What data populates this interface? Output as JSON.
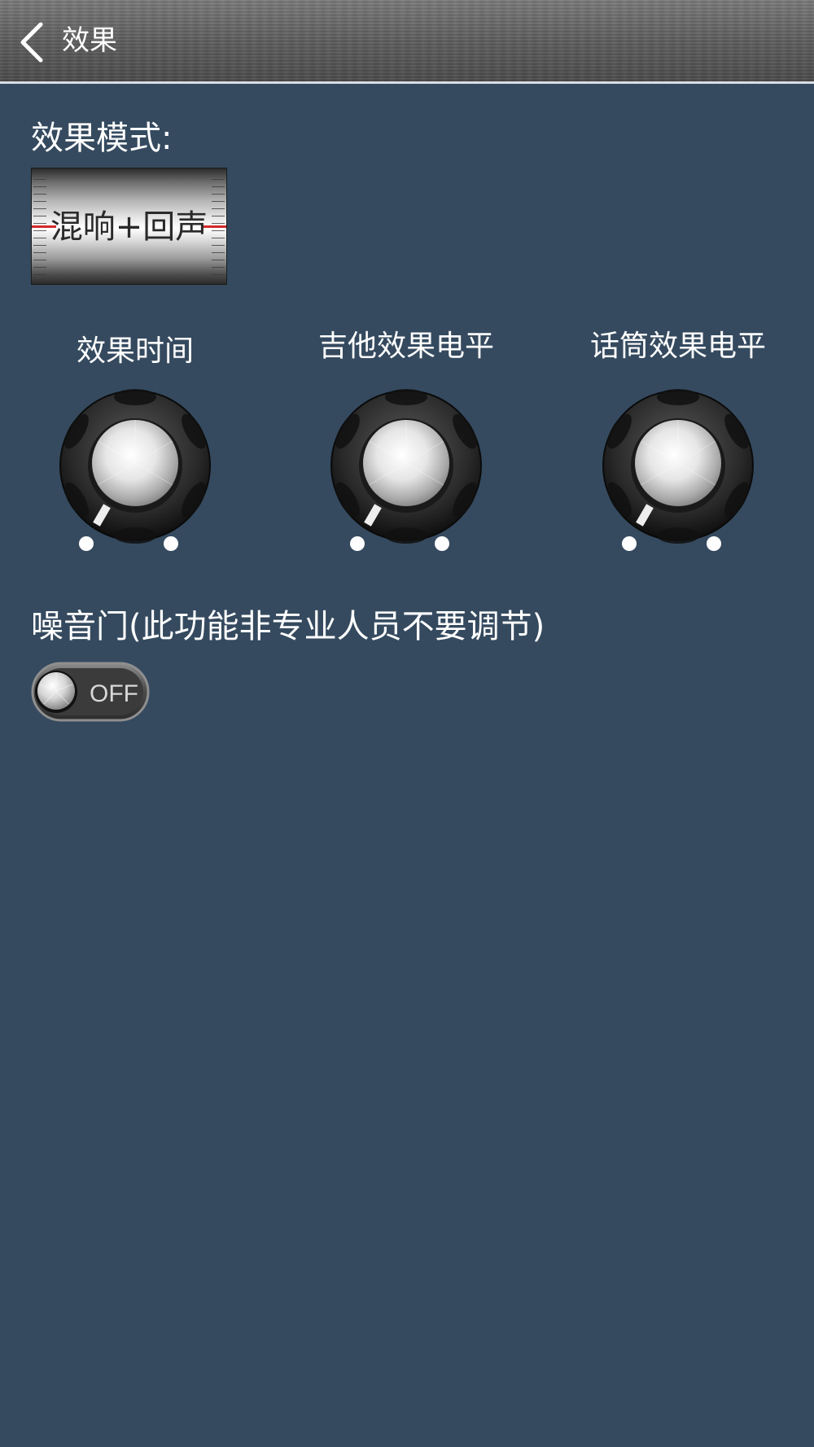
{
  "header": {
    "title": "效果",
    "back_icon": "chevron-left-icon"
  },
  "effect_mode": {
    "label": "效果模式:",
    "value": "混响+回声"
  },
  "knobs": [
    {
      "label": "效果时间",
      "icon": "rotary-knob-icon"
    },
    {
      "label": "吉他效果电平",
      "icon": "rotary-knob-icon"
    },
    {
      "label": "话筒效果电平",
      "icon": "rotary-knob-icon"
    }
  ],
  "noise_gate": {
    "label": "噪音门(此功能非专业人员不要调节)",
    "state": "OFF"
  },
  "colors": {
    "background": "#354a5f",
    "header_line": "#d8dde3",
    "indicator_red": "#d22a2a"
  }
}
